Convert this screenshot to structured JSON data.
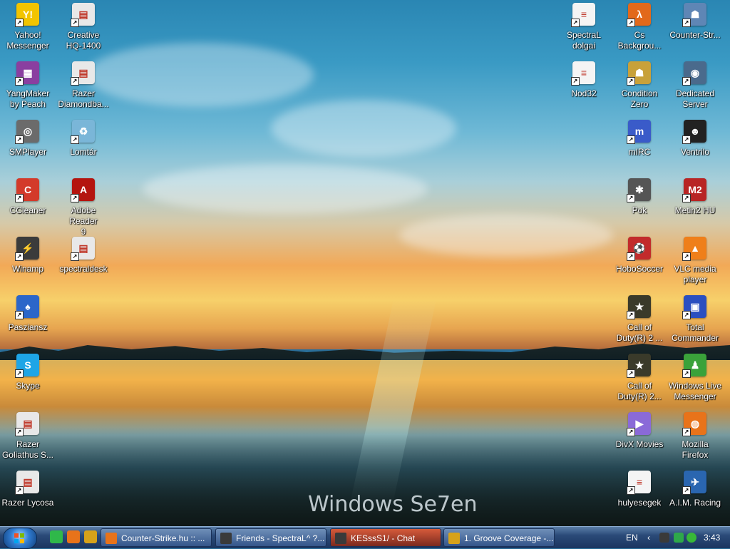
{
  "desktop": {
    "watermark": "Windows Se7en",
    "icons": [
      {
        "label": "Yahoo!\nMessenger",
        "glyph": "Y!",
        "color": "#f2c400"
      },
      {
        "label": "Creative\nHQ-1400",
        "glyph": "▤",
        "color": "#e8e8e8"
      },
      {
        "label": "YangMaker\nby Peach",
        "glyph": "▦",
        "color": "#8a3fa0"
      },
      {
        "label": "Razer\nDiamondba...",
        "glyph": "▤",
        "color": "#e8e8e8"
      },
      {
        "label": "SMPlayer",
        "glyph": "◎",
        "color": "#6b6b6b"
      },
      {
        "label": "Lomtár",
        "glyph": "♻",
        "color": "#7ab6d8"
      },
      {
        "label": "CCleaner",
        "glyph": "C",
        "color": "#d33a2a"
      },
      {
        "label": "Adobe Reader\n9",
        "glyph": "A",
        "color": "#b4140f"
      },
      {
        "label": "Winamp",
        "glyph": "⚡",
        "color": "#3b3b3b"
      },
      {
        "label": "spectraldesk",
        "glyph": "▤",
        "color": "#e8e8e8"
      },
      {
        "label": "Pasziansz",
        "glyph": "♠",
        "color": "#2b66c9"
      },
      {
        "label": "Skype",
        "glyph": "S",
        "color": "#1ea5e6"
      },
      {
        "label": "Razer\nGoliathus S...",
        "glyph": "▤",
        "color": "#e8e8e8"
      },
      {
        "label": "Razer Lycosa",
        "glyph": "▤",
        "color": "#e8e8e8"
      },
      {
        "label": "SpectraL\ndolgai",
        "glyph": "≡",
        "color": "#f4f4f4"
      },
      {
        "label": "Cs\nBackgrou...",
        "glyph": "λ",
        "color": "#e2691b"
      },
      {
        "label": "Counter-Str...",
        "glyph": "☗",
        "color": "#5f86b5"
      },
      {
        "label": "Nod32",
        "glyph": "≡",
        "color": "#f4f4f4"
      },
      {
        "label": "Condition\nZero",
        "glyph": "☗",
        "color": "#c8a13a"
      },
      {
        "label": "Dedicated\nServer",
        "glyph": "◉",
        "color": "#4a6a8c"
      },
      {
        "label": "mIRC",
        "glyph": "m",
        "color": "#3a5bc9"
      },
      {
        "label": "Ventrilo",
        "glyph": "☻",
        "color": "#222222"
      },
      {
        "label": "Pok",
        "glyph": "✱",
        "color": "#555555"
      },
      {
        "label": "Metin2 HU",
        "glyph": "M2",
        "color": "#b82424"
      },
      {
        "label": "HoboSoccer",
        "glyph": "⚽",
        "color": "#c22b2b"
      },
      {
        "label": "VLC media\nplayer",
        "glyph": "▲",
        "color": "#ef7f1a"
      },
      {
        "label": "Call of\nDuty(R) 2 ...",
        "glyph": "★",
        "color": "#3a3a2a"
      },
      {
        "label": "Total\nCommander",
        "glyph": "▣",
        "color": "#2a4fc0"
      },
      {
        "label": "Call of\nDuty(R) 2...",
        "glyph": "★",
        "color": "#3a3a2a"
      },
      {
        "label": "Windows Live\nMessenger",
        "glyph": "♟",
        "color": "#3aa23a"
      },
      {
        "label": "DivX Movies",
        "glyph": "▶",
        "color": "#8a6ad8"
      },
      {
        "label": "Mozilla\nFirefox",
        "glyph": "◍",
        "color": "#e8731a"
      },
      {
        "label": "hulyesegek",
        "glyph": "≡",
        "color": "#f4f4f4"
      },
      {
        "label": "A.I.M. Racing",
        "glyph": "✈",
        "color": "#2a66b0"
      }
    ]
  },
  "taskbar": {
    "quick_launch": [
      {
        "name": "show-desktop-quicklaunch",
        "color": "#2fb84a"
      },
      {
        "name": "firefox-quicklaunch",
        "color": "#e8731a"
      },
      {
        "name": "winamp-quicklaunch",
        "color": "#d6a21a"
      }
    ],
    "tasks": [
      {
        "label": "Counter-Strike.hu :: ...",
        "icon_color": "#e8731a",
        "active": false
      },
      {
        "label": "Friends - SpectraL^ ?...",
        "icon_color": "#3a3a3a",
        "active": false
      },
      {
        "label": "KESssS1/ - Chat",
        "icon_color": "#3a3a3a",
        "active": true
      },
      {
        "label": "1. Groove Coverage -...",
        "icon_color": "#d6a21a",
        "active": false
      }
    ],
    "language": "EN",
    "clock": "3:43"
  }
}
